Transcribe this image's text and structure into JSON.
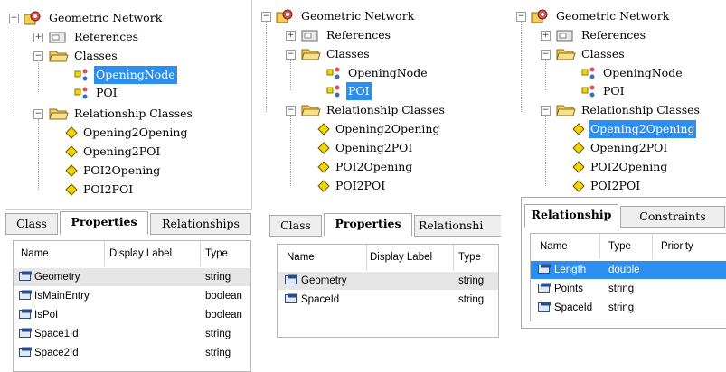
{
  "panels": [
    {
      "tree": {
        "root": "Geometric Network",
        "references": "References",
        "classes": "Classes",
        "class_items": [
          "OpeningNode",
          "POI"
        ],
        "relationship_classes": "Relationship Classes",
        "relationship_items": [
          "Opening2Opening",
          "Opening2POI",
          "POI2Opening",
          "POI2POI"
        ],
        "selected": "OpeningNode"
      },
      "tabs": [
        "Class",
        "Properties",
        "Relationships"
      ],
      "active_tab": "Properties",
      "grid": {
        "columns": [
          "Name",
          "Display Label",
          "Type"
        ],
        "rows": [
          {
            "name": "Geometry",
            "label": "",
            "type": "string"
          },
          {
            "name": "IsMainEntry",
            "label": "",
            "type": "boolean"
          },
          {
            "name": "IsPoI",
            "label": "",
            "type": "boolean"
          },
          {
            "name": "Space1Id",
            "label": "",
            "type": "string"
          },
          {
            "name": "Space2Id",
            "label": "",
            "type": "string"
          }
        ],
        "highlighted_row": 0
      }
    },
    {
      "tree": {
        "root": "Geometric Network",
        "references": "References",
        "classes": "Classes",
        "class_items": [
          "OpeningNode",
          "POI"
        ],
        "relationship_classes": "Relationship Classes",
        "relationship_items": [
          "Opening2Opening",
          "Opening2POI",
          "POI2Opening",
          "POI2POI"
        ],
        "selected": "POI"
      },
      "tabs": [
        "Class",
        "Properties",
        "Relationshi"
      ],
      "active_tab": "Properties",
      "grid": {
        "columns": [
          "Name",
          "Display Label",
          "Type"
        ],
        "rows": [
          {
            "name": "Geometry",
            "label": "",
            "type": "string"
          },
          {
            "name": "SpaceId",
            "label": "",
            "type": "string"
          }
        ],
        "highlighted_row": 0
      }
    },
    {
      "tree": {
        "root": "Geometric Network",
        "references": "References",
        "classes": "Classes",
        "class_items": [
          "OpeningNode",
          "POI"
        ],
        "relationship_classes": "Relationship Classes",
        "relationship_items": [
          "Opening2Opening",
          "Opening2POI",
          "POI2Opening",
          "POI2POI"
        ],
        "selected": "Opening2Opening"
      },
      "tabs": [
        "Relationship",
        "Constraints"
      ],
      "active_tab": "Relationship",
      "grid": {
        "columns": [
          "Name",
          "Type",
          "Priority"
        ],
        "rows": [
          {
            "name": "Length",
            "label": "double",
            "type": ""
          },
          {
            "name": "Points",
            "label": "string",
            "type": ""
          },
          {
            "name": "SpaceId",
            "label": "string",
            "type": ""
          }
        ],
        "selected_row": 0
      }
    }
  ],
  "colors": {
    "selection": "#2a8ff0",
    "row_highlight": "#e6e6e6",
    "diamond": "#f2d600",
    "folder": "#f1cf5a"
  }
}
